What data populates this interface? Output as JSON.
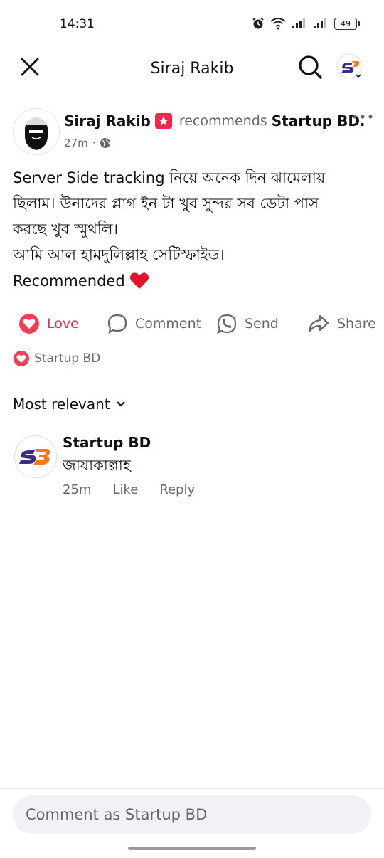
{
  "status_bar": {
    "time": "14:31",
    "battery": "49"
  },
  "header": {
    "title": "Siraj Rakib",
    "icons": [
      "close-icon",
      "search-icon",
      "profile-icon"
    ]
  },
  "post": {
    "author": "Siraj Rakib",
    "recommends_word": "recommends",
    "page": "Startup BD.",
    "time": "27m",
    "separator": "·",
    "privacy_icon": "globe-icon",
    "body_lines": [
      "Server Side tracking নিয়ে অনেক দিন ঝামেলায়",
      "ছিলাম। উনাদের প্লাগ ইন টা খুব সুন্দর সব ডেটা পাস",
      "করছে খুব স্মুথলি।",
      "আমি আল হামদুলিল্লাহ সেটিস্ফাইড।"
    ],
    "recommended_line": "Recommended",
    "heart": "❤️"
  },
  "actions": {
    "love": "Love",
    "comment": "Comment",
    "send": "Send",
    "share": "Share"
  },
  "reactions": {
    "by": "Startup BD"
  },
  "comments_section": {
    "sort_label": "Most relevant",
    "comments": [
      {
        "author": "Startup BD",
        "text": "জাযাকাল্লাহ",
        "time": "25m",
        "like": "Like",
        "reply": "Reply"
      }
    ]
  },
  "composer": {
    "placeholder": "Comment as Startup BD"
  },
  "colors": {
    "love_red": "#f02849",
    "meta_gray": "#65676b",
    "brand_orange": "#f07a1c",
    "brand_purple": "#3b2c8a"
  }
}
